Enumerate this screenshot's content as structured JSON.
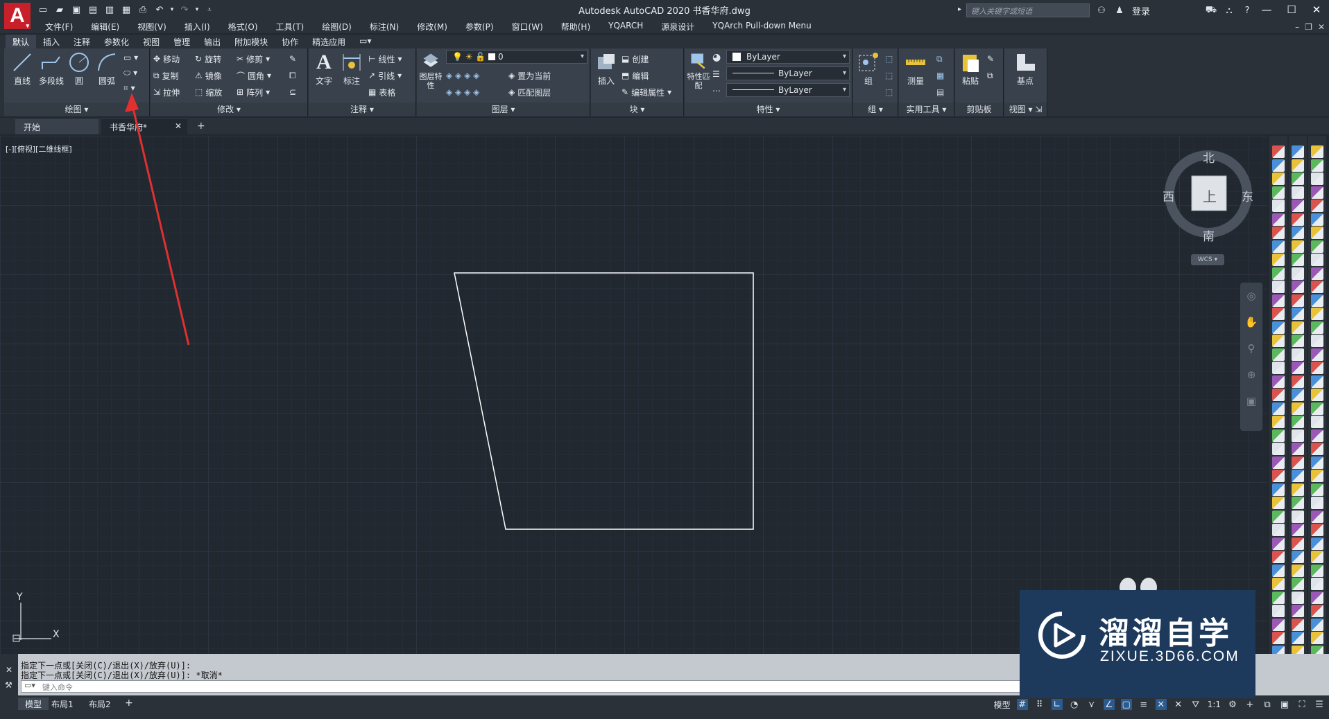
{
  "app": {
    "logo_letter": "A",
    "window_title": "Autodesk AutoCAD 2020    书香华府.dwg",
    "search_placeholder": "键入关键字或短语",
    "login_label": "登录"
  },
  "menu": [
    "文件(F)",
    "编辑(E)",
    "视图(V)",
    "插入(I)",
    "格式(O)",
    "工具(T)",
    "绘图(D)",
    "标注(N)",
    "修改(M)",
    "参数(P)",
    "窗口(W)",
    "帮助(H)",
    "YQARCH",
    "源泉设计",
    "YQArch Pull-down Menu"
  ],
  "ribbon_tabs": [
    "默认",
    "插入",
    "注释",
    "参数化",
    "视图",
    "管理",
    "输出",
    "附加模块",
    "协作",
    "精选应用"
  ],
  "active_ribbon_tab": "默认",
  "draw_panel": {
    "label": "绘图",
    "line": "直线",
    "polyline": "多段线",
    "circle": "圆",
    "arc": "圆弧"
  },
  "modify_panel": {
    "label": "修改",
    "move": "移动",
    "rotate": "旋转",
    "trim": "修剪",
    "copy": "复制",
    "mirror": "镜像",
    "fillet": "圆角",
    "stretch": "拉伸",
    "scale": "缩放",
    "array": "阵列"
  },
  "annotation_panel": {
    "label": "注释",
    "text": "文字",
    "dimension": "标注",
    "linear": "线性",
    "leader": "引线",
    "table": "表格"
  },
  "layers_panel": {
    "label": "图层",
    "layer_properties": "图层特性",
    "current_layer": "0",
    "make_current": "置为当前",
    "match_layer": "匹配图层"
  },
  "block_panel": {
    "label": "块",
    "insert": "插入",
    "create": "创建",
    "edit": "编辑",
    "edit_attributes": "编辑属性"
  },
  "properties_panel": {
    "label": "特性",
    "match": "特性匹配",
    "color": "ByLayer",
    "linetype": "ByLayer",
    "lineweight": "ByLayer"
  },
  "groups_panel": {
    "label": "组",
    "group": "组"
  },
  "utilities_panel": {
    "label": "实用工具",
    "measure": "测量"
  },
  "clipboard_panel": {
    "label": "剪贴板",
    "paste": "粘贴"
  },
  "view_panel": {
    "label": "视图",
    "base": "基点"
  },
  "file_tabs": [
    {
      "label": "开始"
    },
    {
      "label": "书香华府*"
    }
  ],
  "viewport_label": "[-][俯视][二维线框]",
  "viewcube": {
    "north": "北",
    "south": "南",
    "east": "东",
    "west": "西",
    "top": "上",
    "wcs": "WCS"
  },
  "ucs": {
    "x": "X",
    "y": "Y"
  },
  "command_history": [
    "指定下一点或[关闭(C)/退出(X)/放弃(U)]:",
    "指定下一点或[关闭(C)/退出(X)/放弃(U)]: *取消*"
  ],
  "command_placeholder": "键入命令",
  "layout_tabs": [
    "模型",
    "布局1",
    "布局2"
  ],
  "status_bar": {
    "model": "模型",
    "scale": "1:1"
  },
  "watermark": {
    "title": "溜溜自学",
    "url": "ZIXUE.3D66.COM"
  },
  "colors": {
    "canvas": "#212830",
    "ribbon": "#39414c",
    "arrow": "#e03030",
    "shape": "#ffffff",
    "logo": "#c8202a"
  }
}
